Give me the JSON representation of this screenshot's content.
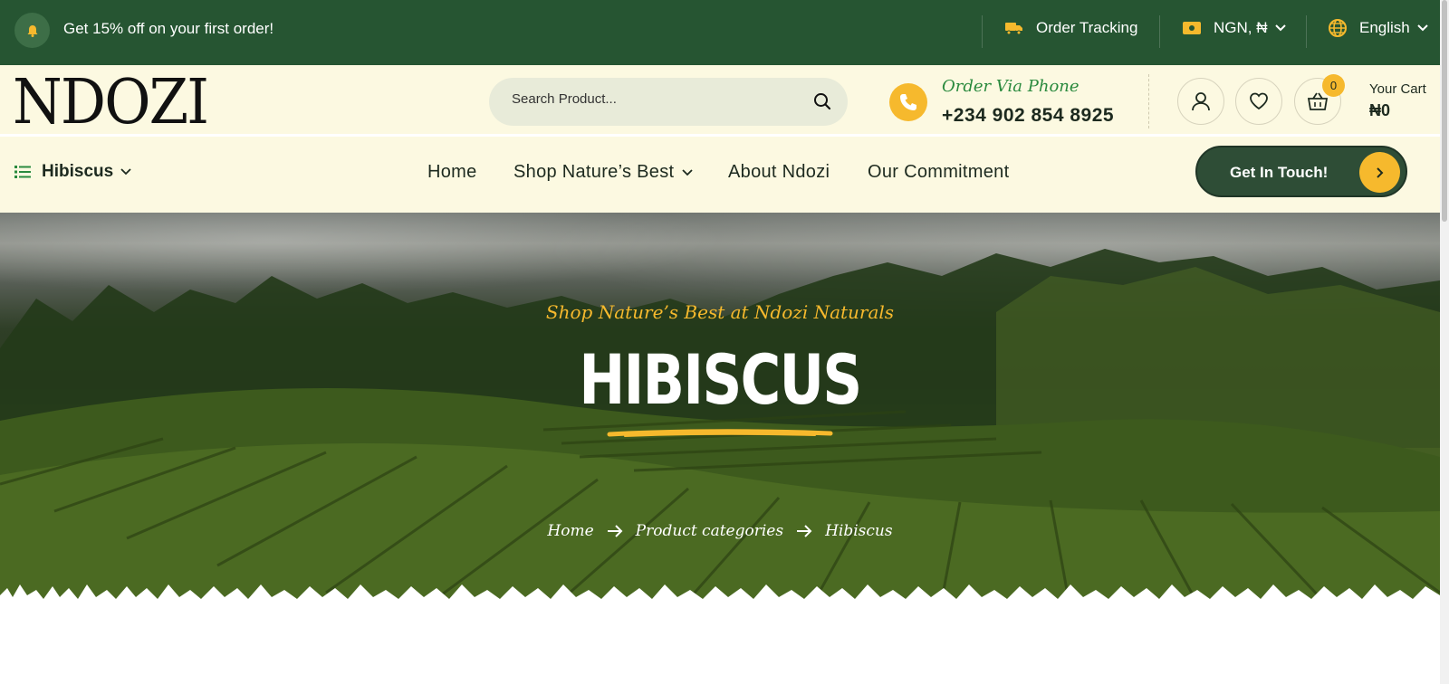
{
  "topbar": {
    "promo": "Get 15% off on your first order!",
    "order_tracking": "Order Tracking",
    "currency": "NGN, ₦",
    "language": "English"
  },
  "header": {
    "logo": "NDOZI",
    "search_placeholder": "Search Product...",
    "phone_label": "Order Via Phone",
    "phone_number": "+234 902 854 8925",
    "cart_count": "0",
    "cart_label": "Your Cart",
    "cart_amount": "₦0"
  },
  "nav": {
    "category": "Hibiscus",
    "links": [
      "Home",
      "Shop Nature’s Best",
      "About Ndozi",
      "Our Commitment"
    ],
    "cta": "Get In Touch!"
  },
  "hero": {
    "tagline": "Shop Nature’s Best at Ndozi Naturals",
    "title": "HIBISCUS",
    "breadcrumb": [
      "Home",
      "Product categories",
      "Hibiscus"
    ]
  },
  "colors": {
    "topbar_bg": "#265532",
    "header_bg": "#fcf9e1",
    "accent": "#f6b92d",
    "cta_bg": "#2e4d36",
    "phone_label": "#2a8a3e"
  },
  "icons": [
    "bell-icon",
    "truck-icon",
    "cash-icon",
    "globe-icon",
    "chevron-down-icon",
    "search-icon",
    "phone-icon",
    "user-icon",
    "heart-icon",
    "basket-icon",
    "list-icon",
    "arrow-right-icon"
  ]
}
